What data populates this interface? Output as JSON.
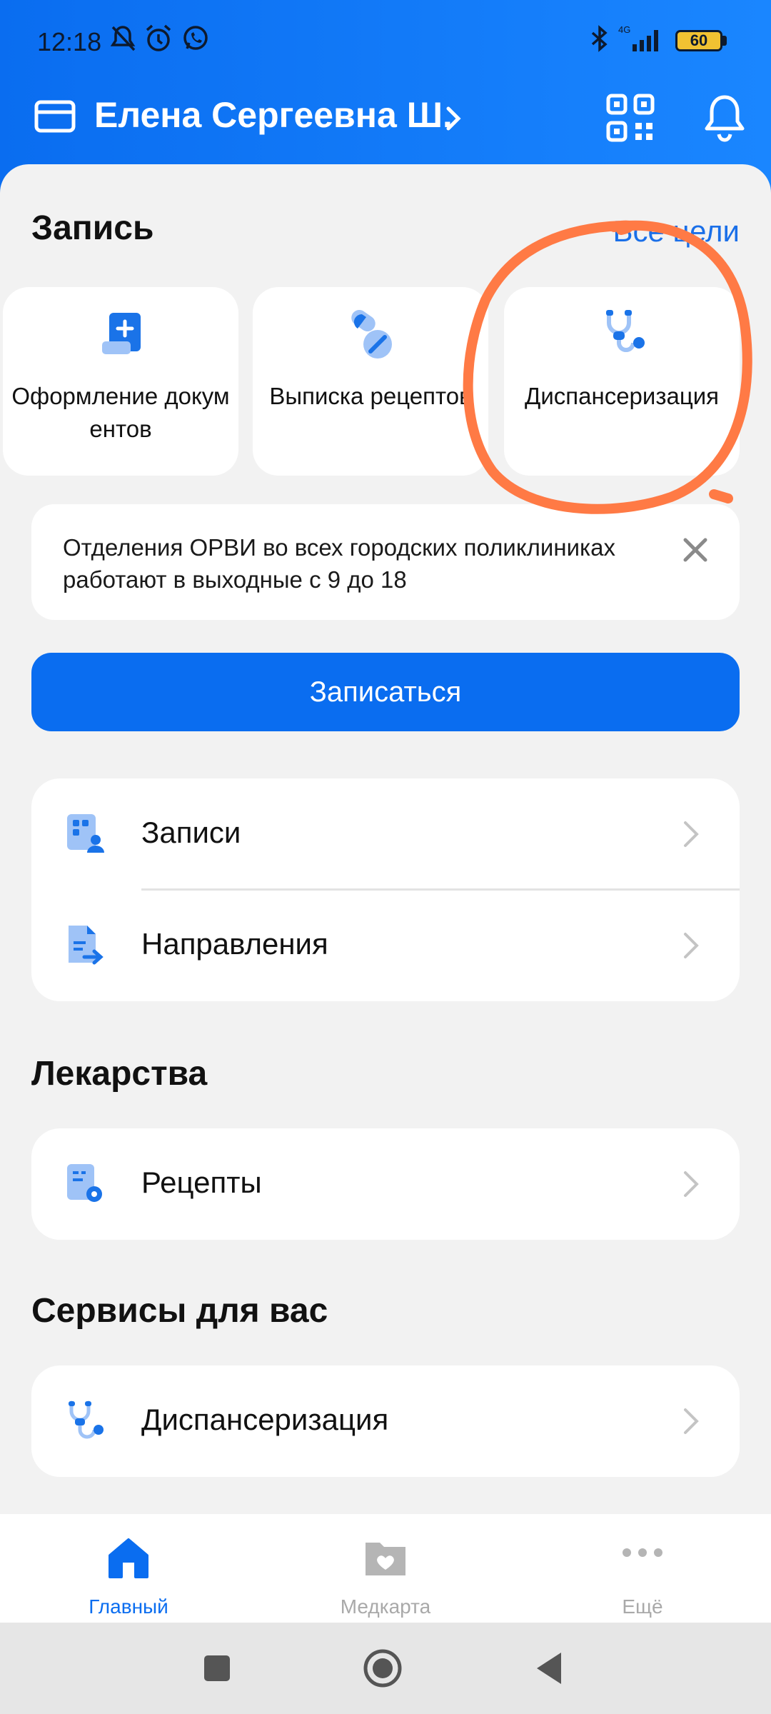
{
  "status_bar": {
    "time": "12:18",
    "battery": "60",
    "icons": [
      "mute-bell-icon",
      "alarm-icon",
      "whatsapp-icon",
      "bluetooth-icon",
      "signal-4g-icon",
      "battery-icon"
    ]
  },
  "header": {
    "profile_name": "Елена Сергеевна Ш.",
    "icons": [
      "card-icon",
      "chevron-right-icon",
      "qr-code-icon",
      "bell-icon"
    ]
  },
  "booking": {
    "title": "Запись",
    "all_goals_link": "Все цели",
    "tiles": [
      {
        "label": "Оформление документов",
        "icon": "document-add-icon"
      },
      {
        "label": "Выписка рецептов",
        "icon": "pills-icon"
      },
      {
        "label": "Диспансеризация",
        "icon": "stethoscope-icon"
      }
    ],
    "notice": "Отделения ОРВИ во всех городских поликлиниках работают в выходные с 9 до 18",
    "primary_button": "Записаться",
    "list": [
      {
        "label": "Записи",
        "icon": "appointments-icon"
      },
      {
        "label": "Направления",
        "icon": "referral-icon"
      }
    ]
  },
  "medicines": {
    "title": "Лекарства",
    "list": [
      {
        "label": "Рецепты",
        "icon": "prescription-icon"
      }
    ]
  },
  "services": {
    "title": "Сервисы для вас",
    "list": [
      {
        "label": "Диспансеризация",
        "icon": "stethoscope-icon"
      }
    ]
  },
  "bottom_nav": [
    {
      "label": "Главный",
      "icon": "home-icon",
      "active": true
    },
    {
      "label": "Медкарта",
      "icon": "medcard-folder-icon",
      "active": false
    },
    {
      "label": "Ещё",
      "icon": "more-dots-icon",
      "active": false
    }
  ],
  "colors": {
    "accent": "#0a6df0",
    "link": "#1a6fe8",
    "annotation": "#ff7a45",
    "inactive": "#a9a9a9"
  }
}
